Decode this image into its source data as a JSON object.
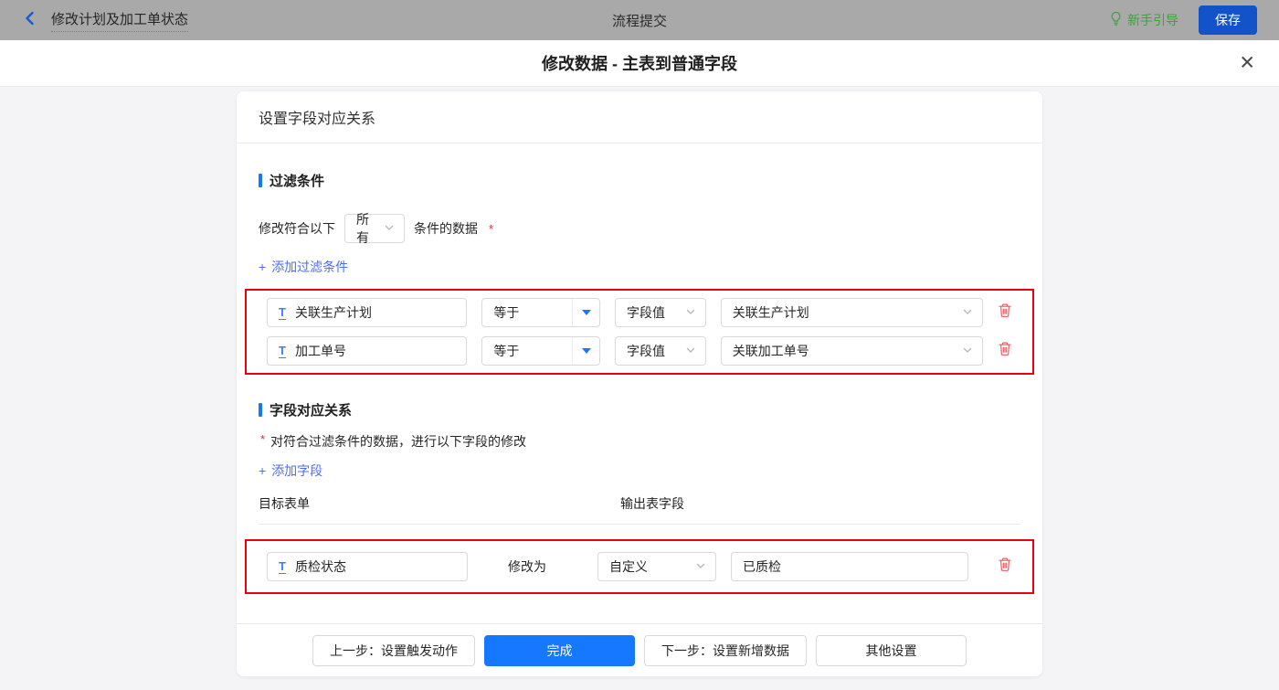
{
  "topbar": {
    "flow_title": "修改计划及加工单状态",
    "center_title": "流程提交",
    "guide_label": "新手引导",
    "save_label": "保存"
  },
  "dialog": {
    "title": "修改数据 - 主表到普通字段",
    "close_glyph": "✕"
  },
  "panel": {
    "header": "设置字段对应关系"
  },
  "filter_section": {
    "title": "过滤条件",
    "match_prefix": "修改符合以下",
    "match_select_value": "所有",
    "match_suffix": "条件的数据",
    "required_mark": "*",
    "add_link_label": "添加过滤条件",
    "rows": [
      {
        "field": "关联生产计划",
        "operator": "等于",
        "value_type": "字段值",
        "value": "关联生产计划"
      },
      {
        "field": "加工单号",
        "operator": "等于",
        "value_type": "字段值",
        "value": "关联加工单号"
      }
    ]
  },
  "mapping_section": {
    "title": "字段对应关系",
    "required_mark": "*",
    "note": "对符合过滤条件的数据，进行以下字段的修改",
    "add_link_label": "添加字段",
    "col_target": "目标表单",
    "col_output": "输出表字段",
    "rows": [
      {
        "field": "质检状态",
        "action": "修改为",
        "value_type": "自定义",
        "value": "已质检"
      }
    ]
  },
  "footer": {
    "prev_label": "上一步：设置触发动作",
    "done_label": "完成",
    "next_label": "下一步：设置新增数据",
    "other_label": "其他设置"
  },
  "icons": {
    "plus_glyph": "+",
    "text_field_glyph": "T"
  },
  "colors": {
    "accent_blue": "#1677ff",
    "link_blue": "#4e6ef2",
    "annotation_red": "#e60012",
    "trash_red": "#f5575e",
    "guide_green": "#3ca23c",
    "save_blue": "#1353c9",
    "topbar_gray": "#a9a9a9"
  }
}
